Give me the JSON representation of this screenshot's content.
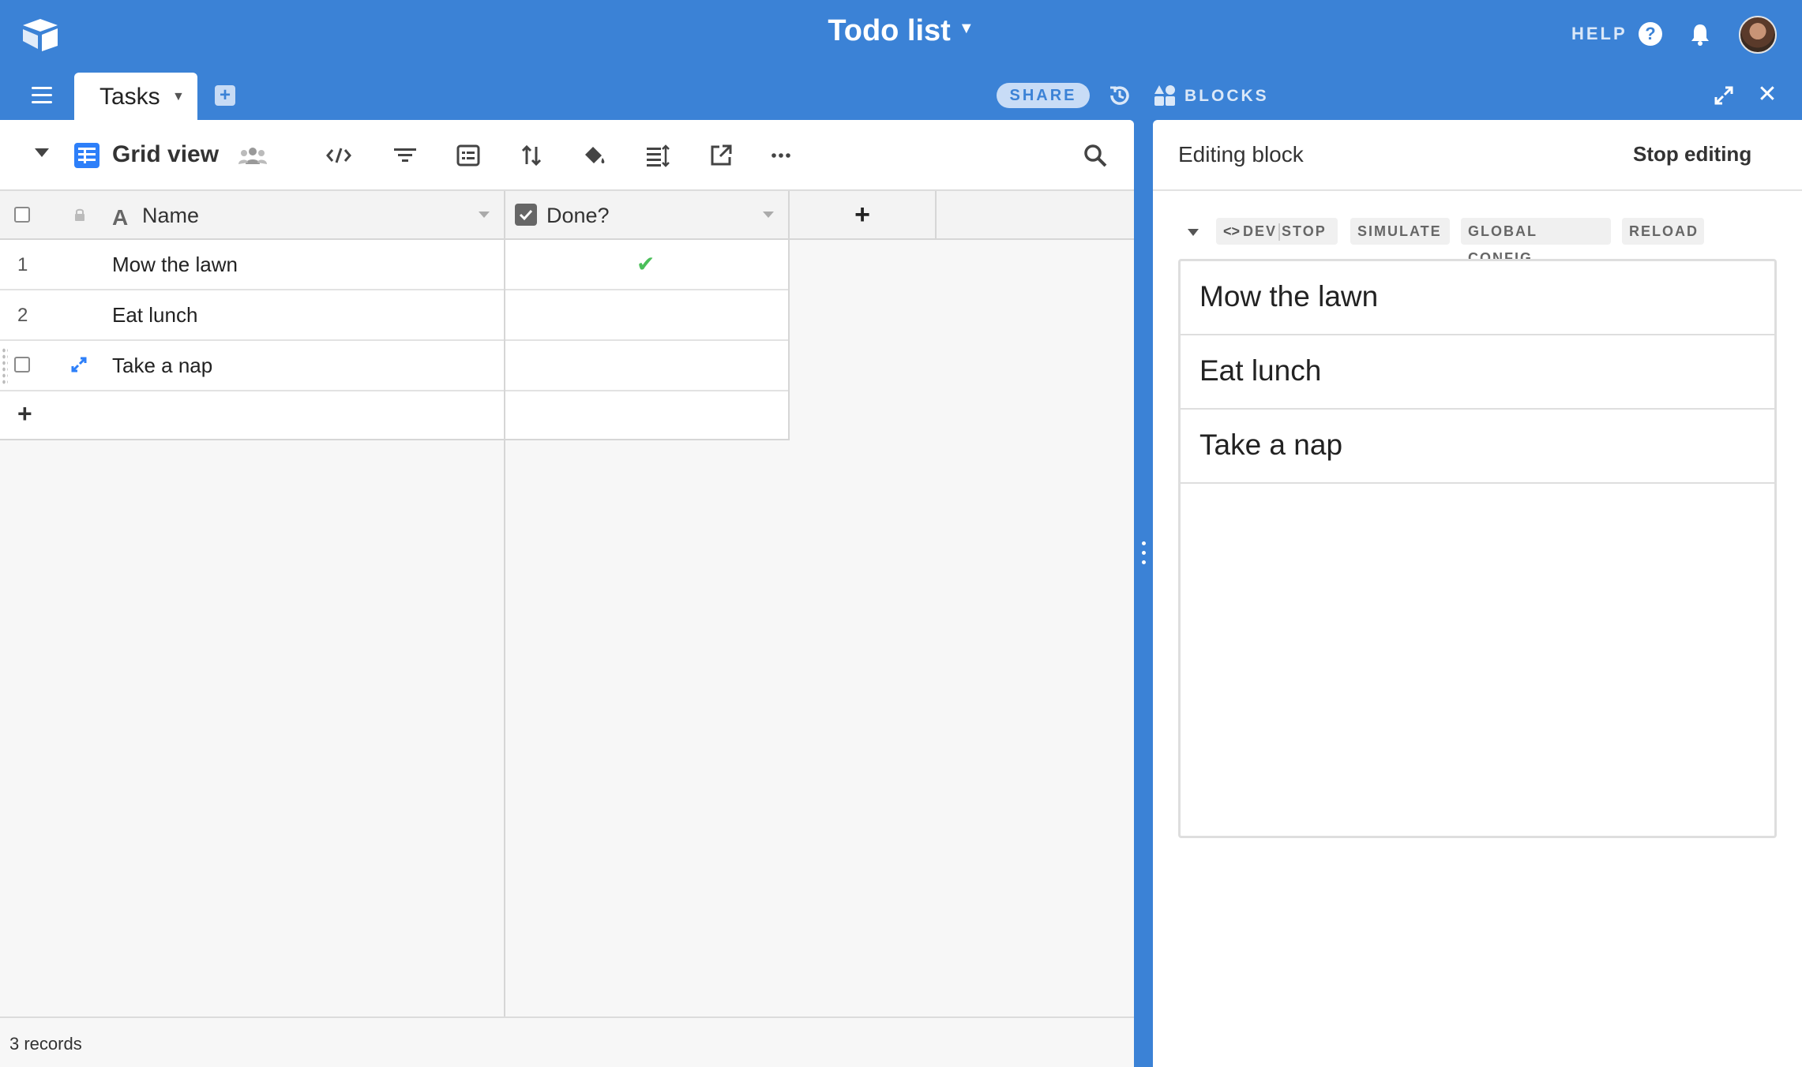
{
  "app": {
    "base_title": "Todo list",
    "help_label": "HELP",
    "colors": {
      "accent": "#3b82d6",
      "check": "#4bbf5a",
      "grid_icon": "#2d7ff9"
    }
  },
  "tabs": [
    {
      "label": "Tasks",
      "active": true
    }
  ],
  "toolbar": {
    "share_label": "SHARE",
    "blocks_label": "BLOCKS"
  },
  "view": {
    "name": "Grid view",
    "icons": [
      "view-caret",
      "grid-icon",
      "people-icon",
      "code-icon",
      "filter-icon",
      "group-icon",
      "sort-icon",
      "color-icon",
      "row-height-icon",
      "share-view-icon",
      "more-icon",
      "search-icon"
    ]
  },
  "grid": {
    "columns": [
      {
        "label": "Name",
        "type": "text"
      },
      {
        "label": "Done?",
        "type": "checkbox"
      }
    ],
    "add_column_label": "+",
    "rows": [
      {
        "num": "1",
        "name": "Mow the lawn",
        "done": "✔"
      },
      {
        "num": "2",
        "name": "Eat lunch",
        "done": ""
      },
      {
        "num": "",
        "name": "Take a nap",
        "done": ""
      }
    ],
    "add_row_label": "+",
    "footer": "3 records"
  },
  "block_panel": {
    "title": "Editing block",
    "stop_label": "Stop editing",
    "dev_controls": {
      "code": "<>",
      "dev": "DEV",
      "stop": "STOP",
      "simulate": "SIMULATE",
      "global_config": "GLOBAL CONFIG",
      "reload": "RELOAD"
    },
    "items": [
      "Mow the lawn",
      "Eat lunch",
      "Take a nap"
    ]
  }
}
